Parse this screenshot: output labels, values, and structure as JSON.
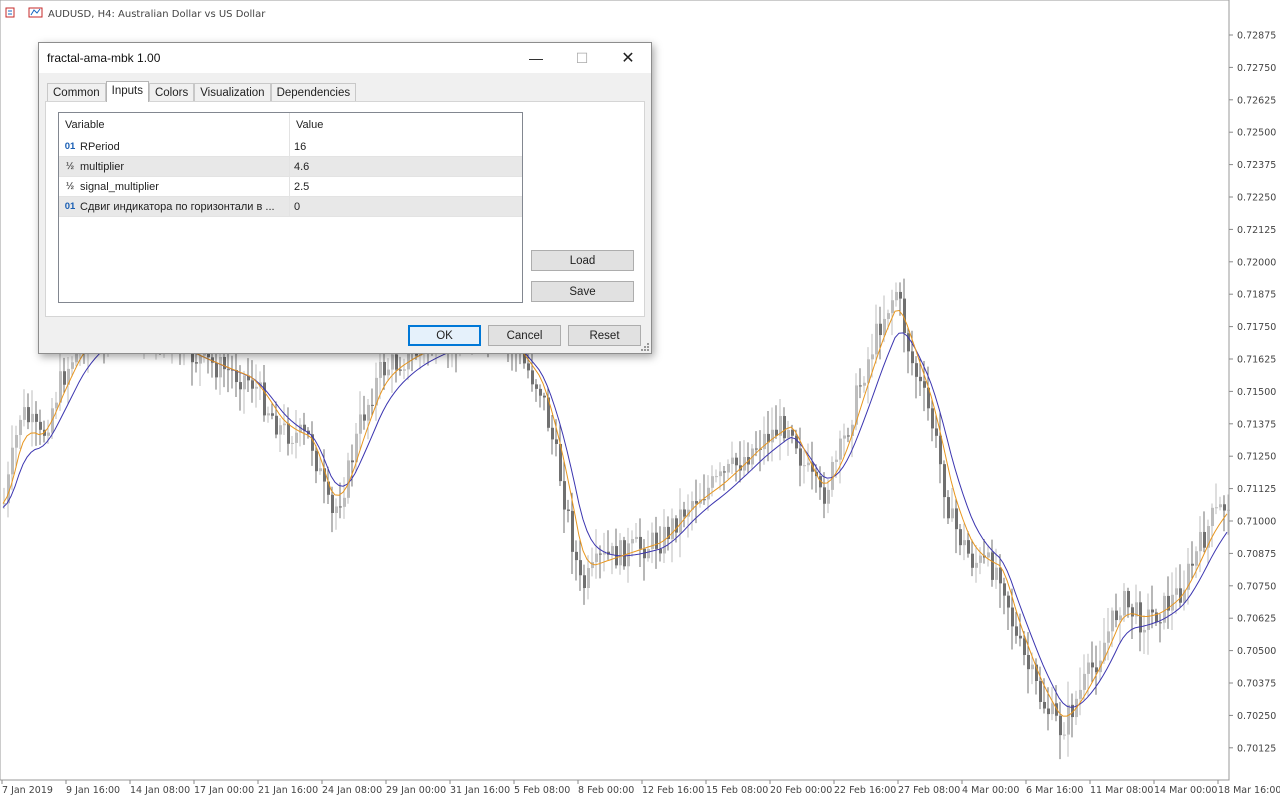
{
  "chart": {
    "title": "AUDUSD, H4:  Australian Dollar vs US Dollar",
    "price_labels": [
      "0.72875",
      "0.72750",
      "0.72625",
      "0.72500",
      "0.72375",
      "0.72250",
      "0.72125",
      "0.72000",
      "0.71875",
      "0.71750",
      "0.71625",
      "0.71500",
      "0.71375",
      "0.71250",
      "0.71125",
      "0.71000",
      "0.70875",
      "0.70750",
      "0.70625",
      "0.70500",
      "0.70375",
      "0.70250",
      "0.70125"
    ],
    "date_labels": [
      "7 Jan 2019",
      "9 Jan 16:00",
      "14 Jan 08:00",
      "17 Jan 00:00",
      "21 Jan 16:00",
      "24 Jan 08:00",
      "29 Jan 00:00",
      "31 Jan 16:00",
      "5 Feb 08:00",
      "8 Feb 00:00",
      "12 Feb 16:00",
      "15 Feb 08:00",
      "20 Feb 00:00",
      "22 Feb 16:00",
      "27 Feb 08:00",
      "4 Mar 00:00",
      "6 Mar 16:00",
      "11 Mar 08:00",
      "14 Mar 00:00",
      "18 Mar 16:00"
    ],
    "colors": {
      "bull": "#bdbdbd",
      "bear": "#707070",
      "signal_line": "#e8961e",
      "ama_line": "#3b35b0",
      "grid": "#dcdcdc",
      "axis_text": "#444444"
    }
  },
  "dialog": {
    "title": "fractal-ama-mbk 1.00",
    "window_buttons": {
      "minimize": "—",
      "maximize": "☐",
      "close": "✕"
    },
    "tabs": [
      "Common",
      "Inputs",
      "Colors",
      "Visualization",
      "Dependencies"
    ],
    "active_tab": "Inputs",
    "grid": {
      "headers": {
        "variable": "Variable",
        "value": "Value"
      },
      "rows": [
        {
          "type_icon": "01",
          "icon_name": "integer-type-icon",
          "name": "RPeriod",
          "value": "16"
        },
        {
          "type_icon": "½",
          "icon_name": "double-type-icon",
          "name": "multiplier",
          "value": "4.6"
        },
        {
          "type_icon": "½",
          "icon_name": "double-type-icon",
          "name": "signal_multiplier",
          "value": "2.5"
        },
        {
          "type_icon": "01",
          "icon_name": "integer-type-icon",
          "name": "Сдвиг индикатора по горизонтали в ...",
          "value": "0"
        }
      ]
    },
    "buttons": {
      "load": "Load",
      "save": "Save",
      "ok": "OK",
      "cancel": "Cancel",
      "reset": "Reset"
    }
  }
}
